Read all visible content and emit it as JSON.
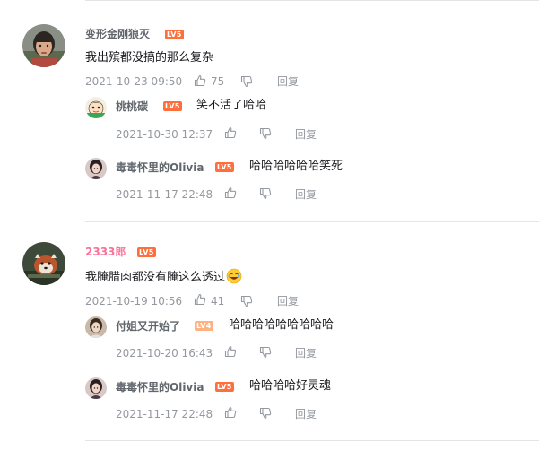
{
  "comments": [
    {
      "user": "变形金刚狼灭",
      "level": "LV5",
      "text": "我出殡都没搞的那么复杂",
      "time": "2021-10-23 09:50",
      "likes": "75",
      "reply_label": "回复",
      "replies": [
        {
          "user": "桃桃碳",
          "level": "LV5",
          "text": "笑不活了哈哈",
          "time": "2021-10-30 12:37",
          "reply_label": "回复"
        },
        {
          "user": "毒毒怀里的Olivia",
          "level": "LV5",
          "text": "哈哈哈哈哈哈笑死",
          "time": "2021-11-17 22:48",
          "reply_label": "回复"
        }
      ]
    },
    {
      "user": "2333郎",
      "level": "LV5",
      "text": "我腌腊肉都没有腌这么透过",
      "time": "2021-10-19 10:56",
      "likes": "41",
      "reply_label": "回复",
      "replies": [
        {
          "user": "付姐又开始了",
          "level": "LV4",
          "text": "哈哈哈哈哈哈哈哈哈",
          "time": "2021-10-20 16:43",
          "reply_label": "回复"
        },
        {
          "user": "毒毒怀里的Olivia",
          "level": "LV5",
          "text": "哈哈哈哈好灵魂",
          "time": "2021-11-17 22:48",
          "reply_label": "回复"
        }
      ]
    }
  ]
}
